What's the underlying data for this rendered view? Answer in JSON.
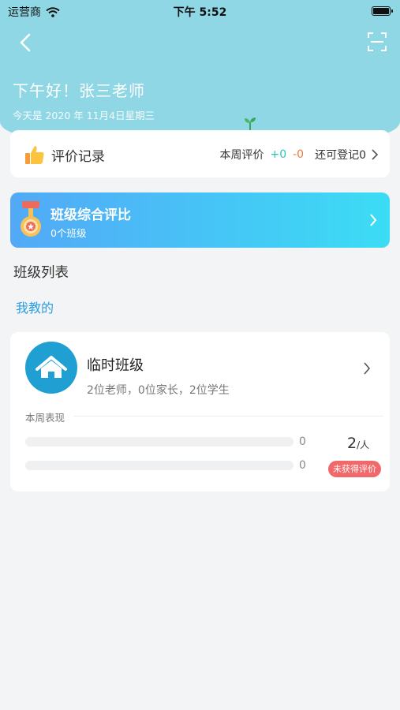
{
  "status_bar": {
    "carrier": "运营商",
    "time": "下午 5:52"
  },
  "header": {
    "greeting": "下午好！张三老师",
    "date_line": "今天是 2020 年 11月4日星期三"
  },
  "record_card": {
    "title": "评价记录",
    "week_label": "本周评价",
    "plus_value": "+0",
    "minus_value": "-0",
    "remaining_label": "还可登记0"
  },
  "compare_card": {
    "title": "班级综合评比",
    "subtitle": "0个班级"
  },
  "section_title": "班级列表",
  "tab_label": "我教的",
  "class_card": {
    "name": "临时班级",
    "meta": "2位老师，0位家长，2位学生",
    "perf_label": "本周表现",
    "bar1_value": "0",
    "bar2_value": "0",
    "bar1_fraction": 0,
    "bar2_fraction": 0,
    "count_num": "2",
    "count_unit": "/人",
    "badge": "未获得评价"
  },
  "colors": {
    "header_bg": "#8fd7e4",
    "accent_blue": "#2b9de3",
    "plus_green": "#2bc3b6",
    "minus_orange": "#f07a3c",
    "badge_red": "#f0686a"
  }
}
